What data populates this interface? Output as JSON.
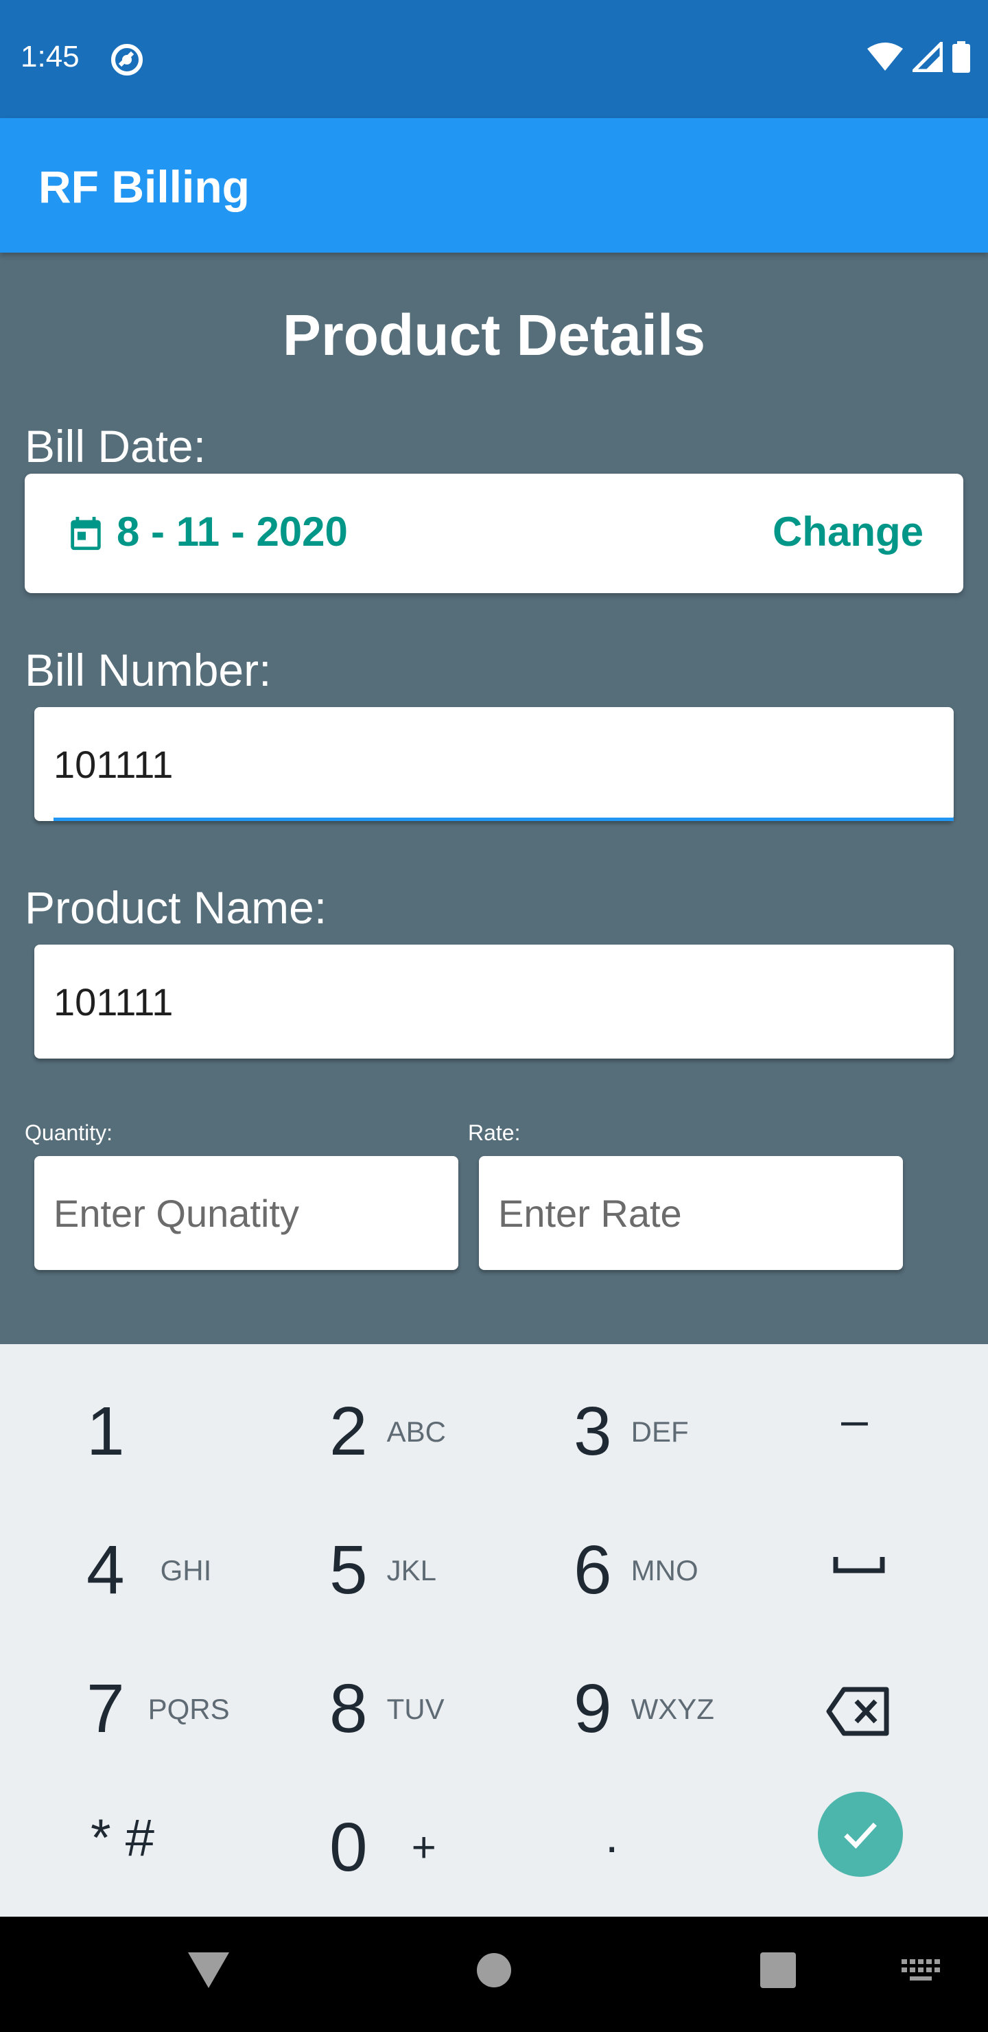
{
  "status_bar": {
    "time": "1:45"
  },
  "app_bar": {
    "title": "RF Billing"
  },
  "form": {
    "heading": "Product Details",
    "bill_date_label": "Bill Date:",
    "bill_date_value": "8 - 11 - 2020",
    "change_label": "Change",
    "bill_number_label": "Bill Number:",
    "bill_number_value": "101111",
    "product_name_label": "Product Name:",
    "product_name_value": "101111",
    "quantity_label": "Quantity:",
    "quantity_placeholder": "Enter Qunatity",
    "rate_label": "Rate:",
    "rate_placeholder": "Enter Rate"
  },
  "keyboard": {
    "keys": [
      {
        "num": "1",
        "letters": ""
      },
      {
        "num": "2",
        "letters": "ABC"
      },
      {
        "num": "3",
        "letters": "DEF"
      },
      {
        "num": "4",
        "letters": "GHI"
      },
      {
        "num": "5",
        "letters": "JKL"
      },
      {
        "num": "6",
        "letters": "MNO"
      },
      {
        "num": "7",
        "letters": "PQRS"
      },
      {
        "num": "8",
        "letters": "TUV"
      },
      {
        "num": "9",
        "letters": "WXYZ"
      },
      {
        "num": "* #",
        "letters": ""
      },
      {
        "num": "0",
        "letters": "+"
      },
      {
        "num": ".",
        "letters": ""
      }
    ],
    "minus_key": "–"
  },
  "colors": {
    "accent": "#009688",
    "app_bar": "#2196f3",
    "status_bar": "#1a6fba",
    "background": "#566e7a"
  }
}
